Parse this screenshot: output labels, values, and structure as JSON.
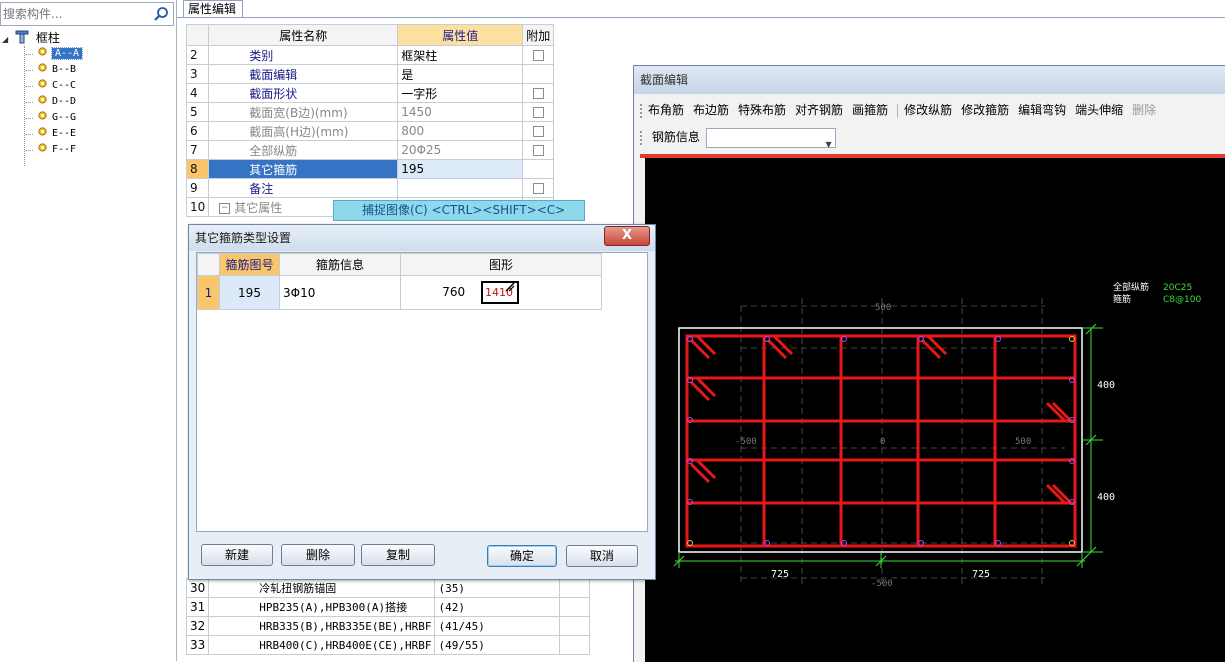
{
  "search": {
    "placeholder": "搜索构件..."
  },
  "tree": {
    "root": "框柱",
    "items": [
      "A--A",
      "B--B",
      "C--C",
      "D--D",
      "G--G",
      "E--E",
      "F--F"
    ],
    "selected_index": 0
  },
  "prop_panel": {
    "tab": "属性编辑",
    "headers": {
      "name": "属性名称",
      "value": "属性值",
      "extra": "附加"
    },
    "rows": [
      {
        "num": "2",
        "name": "类别",
        "value": "框架柱",
        "check": true
      },
      {
        "num": "3",
        "name": "截面编辑",
        "value": "是",
        "check": false
      },
      {
        "num": "4",
        "name": "截面形状",
        "value": "一字形",
        "check": true
      },
      {
        "num": "5",
        "name": "截面宽(B边)(mm)",
        "value": "1450",
        "check": true
      },
      {
        "num": "6",
        "name": "截面高(H边)(mm)",
        "value": "800",
        "check": true
      },
      {
        "num": "7",
        "name": "全部纵筋",
        "value": "20Φ25",
        "check": true
      },
      {
        "num": "8",
        "name": "其它箍筋",
        "value": "195",
        "check": false
      },
      {
        "num": "9",
        "name": "备注",
        "value": "",
        "check": true
      },
      {
        "num": "10",
        "name": "其它属性",
        "value": "",
        "check": false
      }
    ],
    "lower_rows": [
      {
        "num": "30",
        "name": "冷轧扭钢筋锚固",
        "value": "(35)"
      },
      {
        "num": "31",
        "name": "HPB235(A),HPB300(A)搭接",
        "value": "(42)"
      },
      {
        "num": "32",
        "name": "HRB335(B),HRB335E(BE),HRBF",
        "value": "(41/45)"
      },
      {
        "num": "33",
        "name": "HRB400(C),HRB400E(CE),HRBF",
        "value": "(49/55)"
      }
    ]
  },
  "capture_tip": {
    "text": "捕捉图像(C)   <CTRL><SHIFT><C>"
  },
  "section_editor": {
    "title": "截面编辑",
    "toolbar": [
      "布角筋",
      "布边筋",
      "特殊布筋",
      "对齐钢筋",
      "画箍筋",
      "修改纵筋",
      "修改箍筋",
      "编辑弯钩",
      "端头伸缩",
      "删除"
    ],
    "rebar_info_label": "钢筋信息",
    "rebar_info_value": "",
    "legend": {
      "longitudinal_label": "全部纵筋",
      "longitudinal_value": "20C25",
      "stirrup_label": "箍筋",
      "stirrup_value": "C8@100"
    },
    "dims": {
      "height_top": "400",
      "height_bottom": "400",
      "width_left": "725",
      "width_right": "725",
      "grid_top": "500",
      "grid_bottom": "-500",
      "grid_left": "-500",
      "grid_center": "0",
      "grid_right": "500"
    },
    "colors": {
      "background": "#000000",
      "rebar": "#e81818",
      "dim": "#3cdc3c",
      "outline": "#ffffff"
    }
  },
  "dialog": {
    "title": "其它箍筋类型设置",
    "close_label": "X",
    "headers": {
      "code": "箍筋图号",
      "info": "箍筋信息",
      "shape": "图形"
    },
    "rows": [
      {
        "idx": "1",
        "code": "195",
        "info": "3Φ10",
        "dim1": "760",
        "dim2": "1410"
      }
    ],
    "buttons": {
      "new": "新建",
      "delete": "删除",
      "copy": "复制",
      "ok": "确定",
      "cancel": "取消"
    }
  }
}
